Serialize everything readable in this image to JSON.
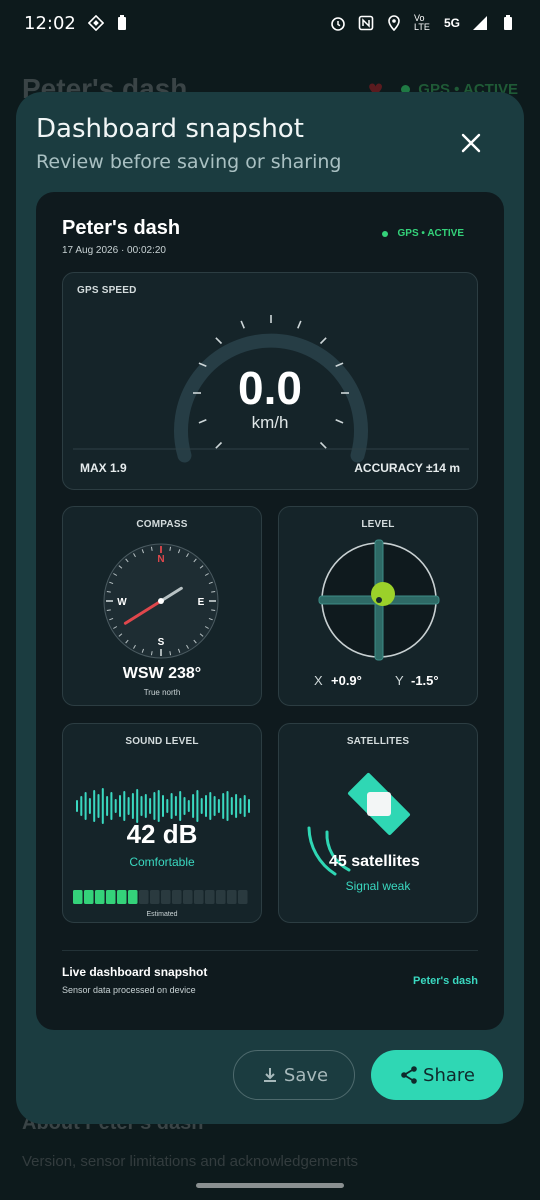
{
  "status_bar": {
    "time": "12:02",
    "network": "5G",
    "volte": "Vo LTE",
    "icons": [
      "alarm-icon",
      "nfc-icon",
      "location-icon",
      "signal-icon",
      "battery-icon"
    ]
  },
  "background": {
    "title": "Peter's dash",
    "gps_status": "GPS • ACTIVE",
    "about_title": "About Peter's dash",
    "about_subtitle": "Version, sensor limitations and acknowledgements"
  },
  "sheet": {
    "title": "Dashboard snapshot",
    "subtitle": "Review before saving or sharing"
  },
  "card": {
    "title": "Peter's dash",
    "date": "17 Aug 2026 · 00:02:20",
    "gps_status": "GPS • ACTIVE",
    "speed": {
      "label": "GPS SPEED",
      "value": "0.0",
      "unit": "km/h",
      "max": "MAX 1.9",
      "accuracy": "ACCURACY ±14 m",
      "fraction": 0
    },
    "compass": {
      "label": "COMPASS",
      "heading": "WSW 238°",
      "subtitle": "True north",
      "north": "N",
      "east": "E",
      "south": "S",
      "west": "W",
      "bearing_degrees": 238
    },
    "level": {
      "label": "LEVEL",
      "x_label": "X",
      "x_value": "+0.9°",
      "y_label": "Y",
      "y_value": "-1.5°"
    },
    "sound": {
      "label": "SOUND LEVEL",
      "value": "42 dB",
      "status": "Comfortable",
      "estimated": "Estimated",
      "level_segments_on": 6,
      "level_segments_total": 16
    },
    "satellites": {
      "label": "SATELLITES",
      "count": "45 satellites",
      "status": "Signal weak"
    },
    "footer": {
      "title": "Live dashboard snapshot",
      "subtitle": "Sensor data processed on device",
      "brand": "Peter's dash"
    }
  },
  "actions": {
    "save_label": "Save",
    "share_label": "Share"
  },
  "colors": {
    "accent": "#2fd7b4",
    "active_green": "#34d27a",
    "compass_needle": "#e0474c",
    "level_bubble": "#9bd12a"
  }
}
